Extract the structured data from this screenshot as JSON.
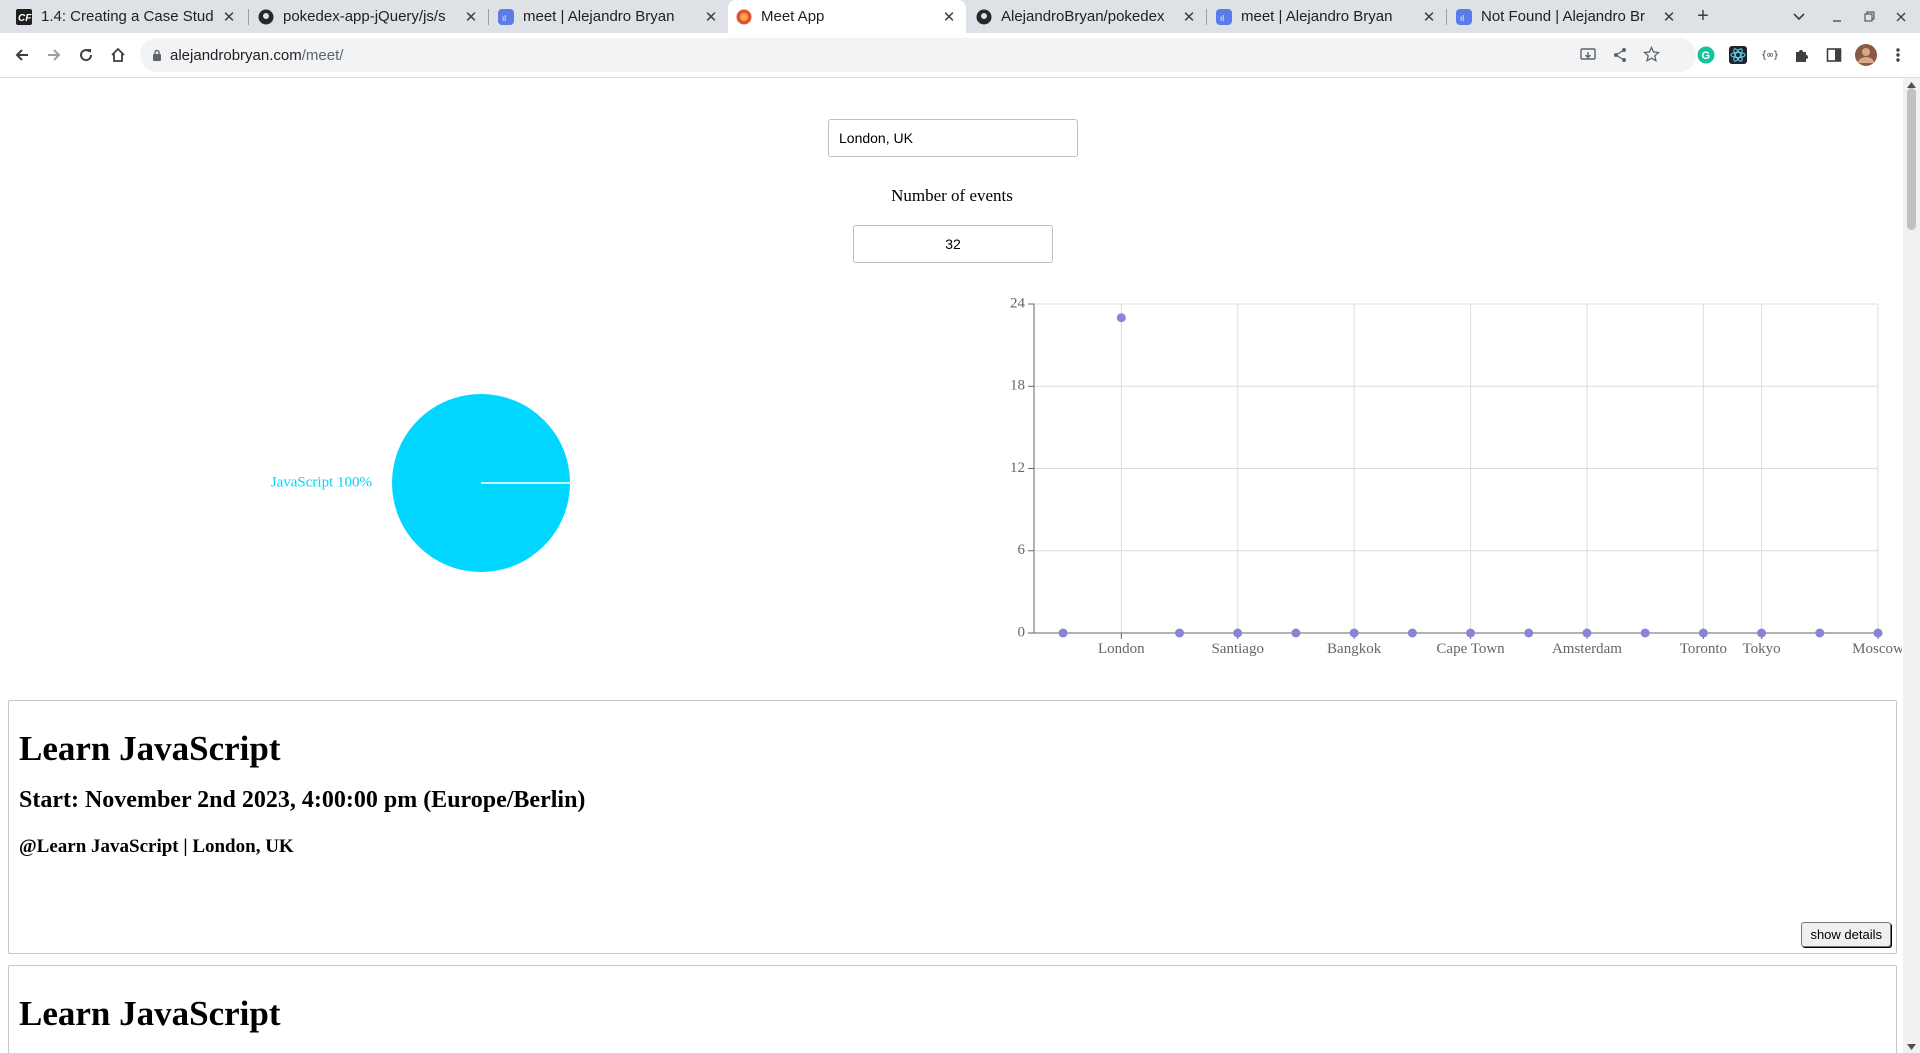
{
  "browser": {
    "tabs": [
      {
        "title": "1.4: Creating a Case Stud",
        "icon": "cf-logo-icon"
      },
      {
        "title": "pokedex-app-jQuery/js/s",
        "icon": "github-icon"
      },
      {
        "title": "meet | Alejandro Bryan",
        "icon": "app-icon"
      },
      {
        "title": "Meet App",
        "icon": "meet-app-icon"
      },
      {
        "title": "AlejandroBryan/pokedex",
        "icon": "github-icon"
      },
      {
        "title": "meet | Alejandro Bryan",
        "icon": "app-icon"
      },
      {
        "title": "Not Found | Alejandro Br",
        "icon": "app-icon"
      }
    ],
    "active_tab": 3,
    "url_host": "alejandrobryan.com",
    "url_path": "/meet/"
  },
  "page": {
    "city_input_value": "London, UK",
    "number_label": "Number of events",
    "number_input_value": "32"
  },
  "chart_data": [
    {
      "type": "pie",
      "labels": [
        "JavaScript"
      ],
      "values": [
        100
      ],
      "slice_labels": [
        "JavaScript 100%"
      ],
      "colors": [
        "#00d6ff"
      ]
    },
    {
      "type": "scatter",
      "categories": [
        "",
        "London",
        "",
        "Santiago",
        "",
        "Bangkok",
        "",
        "Cape Town",
        "",
        "Amsterdam",
        "",
        "Toronto",
        "Tokyo",
        "",
        "Moscow"
      ],
      "values": [
        0,
        23,
        0,
        0,
        0,
        0,
        0,
        0,
        0,
        0,
        0,
        0,
        0,
        0,
        0
      ],
      "ylim": [
        0,
        24
      ],
      "yticks": [
        0,
        6,
        12,
        18,
        24
      ],
      "grid": true,
      "point_color": "#8884d8"
    }
  ],
  "events": [
    {
      "title": "Learn JavaScript",
      "start": "Start: November 2nd 2023, 4:00:00 pm (Europe/Berlin)",
      "location": "@Learn JavaScript | London, UK",
      "button": "show details"
    },
    {
      "title": "Learn JavaScript"
    }
  ]
}
